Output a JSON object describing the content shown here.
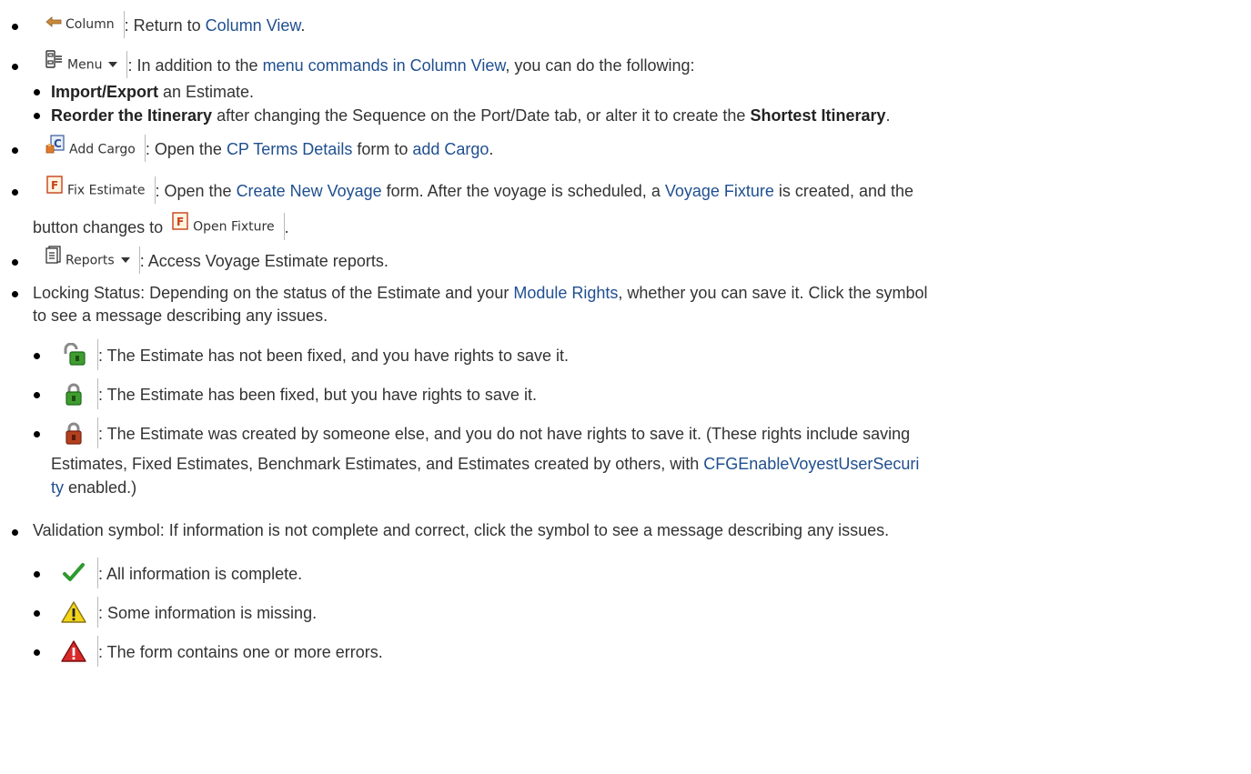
{
  "items": {
    "column": {
      "button_label": "Column",
      "text_a": ": Return to ",
      "link": "Column View",
      "text_b": "."
    },
    "menu": {
      "button_label": "Menu",
      "text_a": ": In addition to the ",
      "link": "menu commands in Column View",
      "text_b": ", you can do the following:",
      "sub": [
        {
          "bold_a": "Import/Export",
          "text_a": " an Estimate."
        },
        {
          "bold_a": "Reorder the Itinerary",
          "text_a": " after changing the Sequence on the Port/Date tab, or alter it to create the ",
          "bold_b": "Shortest Itinerary",
          "text_b": "."
        }
      ]
    },
    "add_cargo": {
      "button_label": "Add Cargo",
      "text_a": ": Open the ",
      "link_a": "CP Terms Details",
      "text_b": " form to ",
      "link_b": "add Cargo",
      "text_c": "."
    },
    "fix_estimate": {
      "button_label": "Fix Estimate",
      "text_a": ": Open the ",
      "link_a": "Create New Voyage",
      "text_b": " form. After the voyage is scheduled, a ",
      "link_b": "Voyage Fixture",
      "text_c": " is created, and the",
      "line2_text": "button changes to ",
      "open_fixture_label": "Open Fixture",
      "line2_end": "."
    },
    "reports": {
      "button_label": "Reports",
      "text_a": ": Access Voyage Estimate reports."
    },
    "locking": {
      "text_a": "Locking Status: Depending on the status of the Estimate and your ",
      "link": "Module Rights",
      "text_b": ", whether you can save it. Click the symbol",
      "line2": "to see a message describing any issues.",
      "sub": [
        {
          "icon": "unlocked-green-icon",
          "text": ": The Estimate has not been fixed, and you have rights to save it."
        },
        {
          "icon": "locked-green-icon",
          "text": ": The Estimate has been fixed, but you have rights to save it."
        },
        {
          "icon": "locked-red-icon",
          "text": ": The Estimate was created by someone else, and you do not have rights to save it. (These rights include saving",
          "line2_text": "Estimates, Fixed Estimates, Benchmark Estimates, and Estimates created by others, with ",
          "line2_link": "CFGEnableVoyestUserSecuri",
          "line3_link": "ty",
          "line3_text": " enabled.)"
        }
      ]
    },
    "validation": {
      "text": "Validation symbol: If information is not complete and correct, click the symbol to see a message describing any issues.",
      "sub": [
        {
          "icon": "check-icon",
          "text": ": All information is complete."
        },
        {
          "icon": "warning-yellow-icon",
          "text": ": Some information is missing."
        },
        {
          "icon": "warning-red-icon",
          "text": ": The form contains one or more errors."
        }
      ]
    }
  },
  "colors": {
    "link": "#1f4f8f",
    "text": "#333333",
    "lock_green": "#3f9c2f",
    "lock_red": "#b2401f",
    "check_green": "#2e9a2e",
    "warn_yellow": "#f2d51c",
    "warn_red": "#d82a2a"
  }
}
